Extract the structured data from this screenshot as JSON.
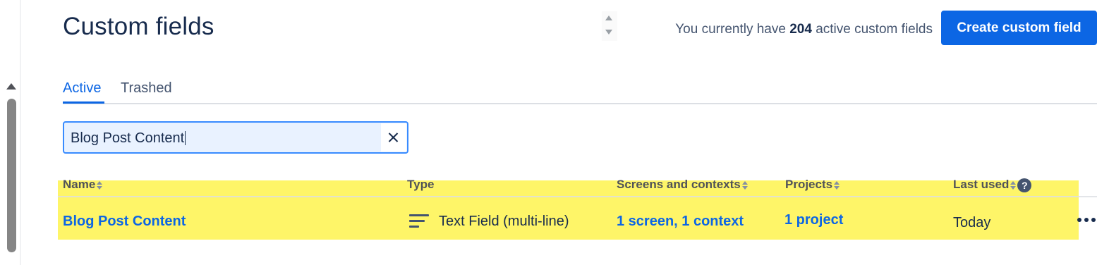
{
  "header": {
    "title": "Custom fields",
    "count_prefix": "You currently have",
    "count_value": "204",
    "count_suffix": "active custom fields",
    "create_button": "Create custom field"
  },
  "tabs": [
    {
      "label": "Active",
      "active": true
    },
    {
      "label": "Trashed",
      "active": false
    }
  ],
  "search": {
    "value": "Blog Post Content"
  },
  "table": {
    "columns": [
      {
        "label": "Name",
        "sortable": true
      },
      {
        "label": "Type",
        "sortable": false
      },
      {
        "label": "Screens and contexts",
        "sortable": true
      },
      {
        "label": "Projects",
        "sortable": true
      },
      {
        "label": "Last used",
        "sortable": true,
        "help_icon": "question-icon"
      }
    ],
    "rows": [
      {
        "name": "Blog Post Content",
        "type_icon": "text-lines-icon",
        "type": "Text Field (multi-line)",
        "screens_contexts": "1 screen, 1 context",
        "projects": "1 project",
        "last_used": "Today"
      }
    ]
  },
  "help_icon_glyph": "?",
  "colors": {
    "accent": "#0c66e4",
    "highlight": "#fef568",
    "text": "#172b4d"
  }
}
